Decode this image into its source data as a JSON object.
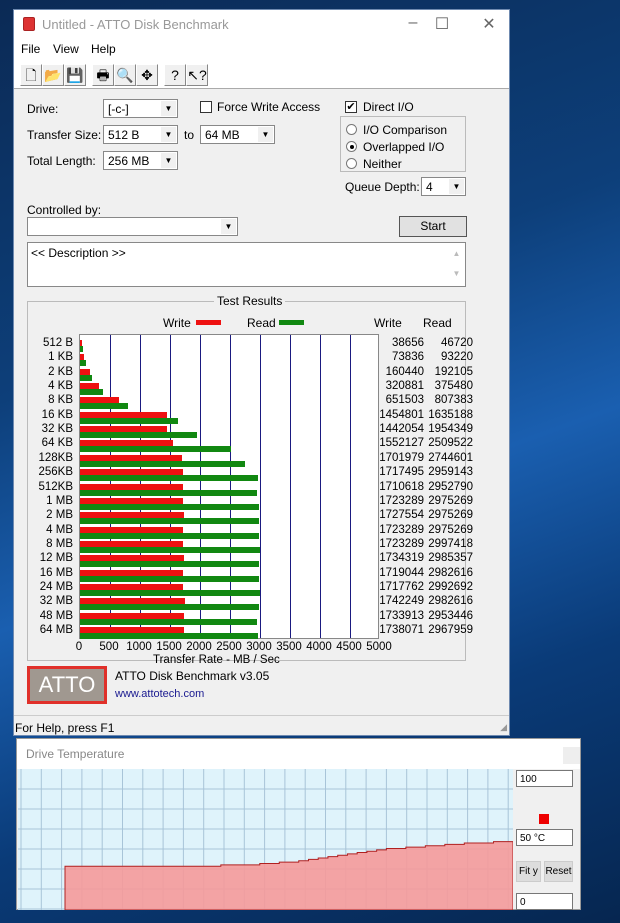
{
  "window": {
    "title": "Untitled - ATTO Disk Benchmark",
    "minimize": "–",
    "maximize": "☐",
    "close": "✕"
  },
  "menu": [
    "File",
    "View",
    "Help"
  ],
  "toolbar": [
    {
      "icon": "new-document-icon",
      "glyph": "🗋"
    },
    {
      "icon": "open-folder-icon",
      "glyph": "📂"
    },
    {
      "icon": "save-disk-icon",
      "glyph": "💾"
    },
    {
      "icon": "print-icon",
      "glyph": "🖶"
    },
    {
      "icon": "print-preview-icon",
      "glyph": "🔍"
    },
    {
      "icon": "move-arrows-icon",
      "glyph": "✥"
    },
    {
      "icon": "help-icon",
      "glyph": "?"
    },
    {
      "icon": "context-help-icon",
      "glyph": "↖?"
    }
  ],
  "settings": {
    "drive_label": "Drive:",
    "drive_value": "[-c-]",
    "force_write_label": "Force Write Access",
    "force_write_checked": false,
    "direct_io_label": "Direct I/O",
    "direct_io_checked": true,
    "transfer_size_label": "Transfer Size:",
    "transfer_from": "512 B",
    "to_label": "to",
    "transfer_to": "64 MB",
    "total_length_label": "Total Length:",
    "total_length": "256 MB",
    "io_options": [
      {
        "label": "I/O Comparison",
        "selected": false
      },
      {
        "label": "Overlapped I/O",
        "selected": true
      },
      {
        "label": "Neither",
        "selected": false
      }
    ],
    "queue_depth_label": "Queue Depth:",
    "queue_depth": "4",
    "controlled_by_label": "Controlled by:",
    "controlled_by_value": "",
    "start_label": "Start",
    "description": "<< Description >>"
  },
  "results": {
    "group_title": "Test Results",
    "write_label": "Write",
    "read_label": "Read",
    "col_write": "Write",
    "col_read": "Read",
    "write_color": "#ee1111",
    "read_color": "#118811"
  },
  "chart_data": {
    "type": "bar",
    "orientation": "horizontal",
    "title": "Test Results",
    "xlabel": "Transfer Rate - MB / Sec",
    "xlim": [
      0,
      5000
    ],
    "xticks": [
      "0",
      "500",
      "1000",
      "1500",
      "2000",
      "2500",
      "3000",
      "3500",
      "4000",
      "4500",
      "5000"
    ],
    "categories": [
      "512 B",
      "1 KB",
      "2 KB",
      "4 KB",
      "8 KB",
      "16 KB",
      "32 KB",
      "64 KB",
      "128KB",
      "256KB",
      "512KB",
      "1 MB",
      "2 MB",
      "4 MB",
      "8 MB",
      "12 MB",
      "16 MB",
      "24 MB",
      "32 MB",
      "48 MB",
      "64 MB"
    ],
    "series": [
      {
        "name": "Write",
        "values": [
          38656,
          73836,
          160440,
          320881,
          651503,
          1454801,
          1442054,
          1552127,
          1701979,
          1717495,
          1710618,
          1723289,
          1727554,
          1723289,
          1723289,
          1734319,
          1719044,
          1717762,
          1742249,
          1733913,
          1738071
        ]
      },
      {
        "name": "Read",
        "values": [
          46720,
          93220,
          192105,
          375480,
          807383,
          1635188,
          1954349,
          2509522,
          2744601,
          2959143,
          2952790,
          2975269,
          2975269,
          2975269,
          2997418,
          2985357,
          2982616,
          2992692,
          2982616,
          2953446,
          2967959
        ]
      }
    ],
    "legend": "top"
  },
  "footer": {
    "logo": "ATTO",
    "version": "ATTO Disk Benchmark v3.05",
    "url": "www.attotech.com"
  },
  "status": "For Help, press F1",
  "temperature": {
    "title": "Drive Temperature",
    "max": "100",
    "current": "50 °C",
    "min": "0",
    "fit_label": "Fit y",
    "reset_label": "Reset",
    "line_color": "#b02020",
    "fill_color": "#f59a9a",
    "history": [
      32,
      32,
      32,
      32,
      32,
      32,
      32,
      32,
      32,
      32,
      32,
      32,
      32,
      32,
      32,
      32,
      33,
      33,
      33,
      33,
      34,
      34,
      35,
      35,
      36,
      37,
      38,
      39,
      40,
      41,
      42,
      43,
      44,
      45,
      45,
      46,
      46,
      47,
      47,
      48,
      48,
      49,
      49,
      49,
      50,
      50,
      50
    ]
  }
}
